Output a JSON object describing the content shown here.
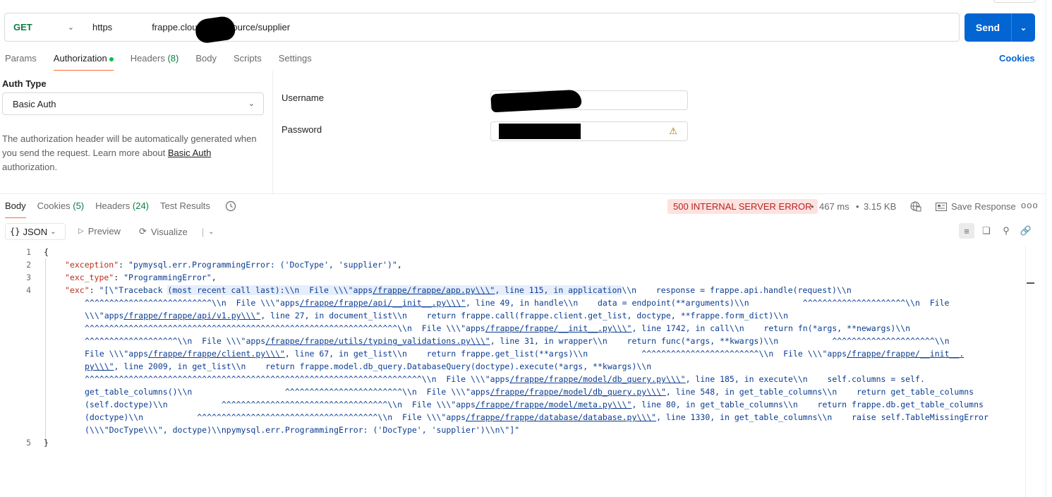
{
  "request": {
    "method": "GET",
    "url_prefix": "https",
    "url_suffix": "frappe.cloud/api/resource/supplier",
    "send_label": "Send"
  },
  "request_tabs": [
    {
      "label": "Params",
      "count": ""
    },
    {
      "label": "Authorization",
      "count": ""
    },
    {
      "label": "Headers",
      "count": "(8)"
    },
    {
      "label": "Body",
      "count": ""
    },
    {
      "label": "Scripts",
      "count": ""
    },
    {
      "label": "Settings",
      "count": ""
    }
  ],
  "cookies_link": "Cookies",
  "auth": {
    "type_label": "Auth Type",
    "type_value": "Basic Auth",
    "desc_before": "The authorization header will be automatically generated when you send the request. Learn more about ",
    "desc_link": "Basic Auth",
    "desc_after": " authorization.",
    "username_label": "Username",
    "password_label": "Password",
    "warning_icon": "warning-triangle-icon"
  },
  "response_tabs": [
    {
      "label": "Body",
      "count": ""
    },
    {
      "label": "Cookies",
      "count": "(5)"
    },
    {
      "label": "Headers",
      "count": "(24)"
    },
    {
      "label": "Test Results",
      "count": ""
    }
  ],
  "response": {
    "status": "500 INTERNAL SERVER ERROR",
    "time": "467 ms",
    "size": "3.15 KB",
    "save_label": "Save Response",
    "more": "ooo"
  },
  "toolbar": {
    "format": "JSON",
    "preview": "Preview",
    "visualize": "Visualize"
  },
  "code": {
    "line_numbers": [
      "1",
      "2",
      "3",
      "4",
      "5"
    ],
    "l1": "{",
    "l2_key": "\"exception\"",
    "l2_val": "\"pymysql.err.ProgrammingError: ('DocType', 'supplier')\"",
    "l3_key": "\"exc_type\"",
    "l3_val": "\"ProgrammingError\"",
    "l4_key": "\"exc\"",
    "l5": "}"
  }
}
